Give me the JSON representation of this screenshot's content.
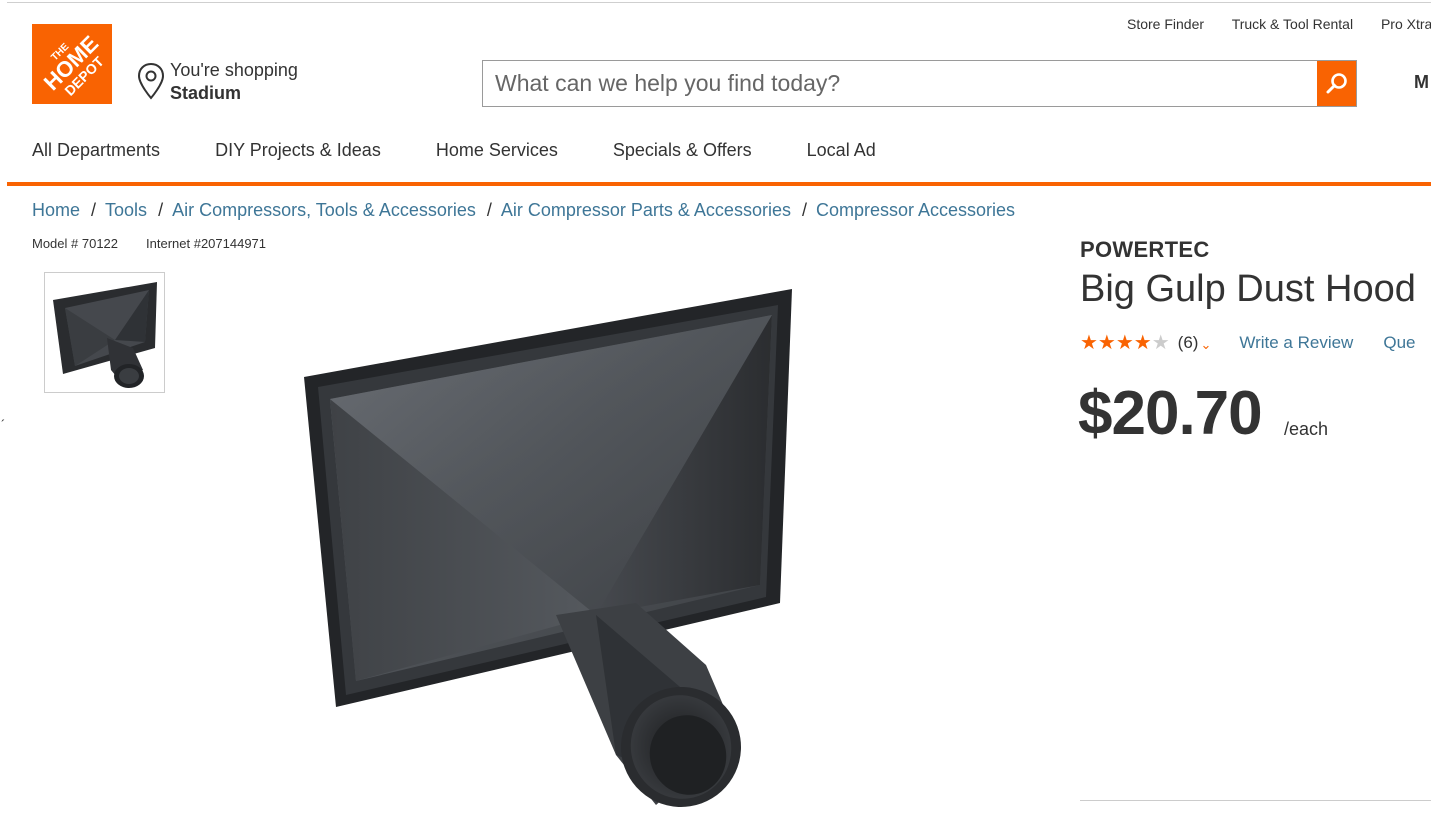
{
  "header": {
    "logo_text": "THE HOME DEPOT",
    "store": {
      "prefix": "You're shopping",
      "name": "Stadium"
    },
    "utility_links": [
      "Store Finder",
      "Truck & Tool Rental",
      "Pro Xtra"
    ],
    "search": {
      "placeholder": "What can we help you find today?",
      "value": ""
    },
    "my_account_initial": "M"
  },
  "nav": {
    "items": [
      "All Departments",
      "DIY Projects & Ideas",
      "Home Services",
      "Specials & Offers",
      "Local Ad"
    ]
  },
  "breadcrumbs": [
    "Home",
    "Tools",
    "Air Compressors, Tools & Accessories",
    "Air Compressor Parts & Accessories",
    "Compressor Accessories"
  ],
  "product": {
    "model": "Model # 70122",
    "internet": "Internet #207144971",
    "brand": "POWERTEC",
    "title": "Big Gulp Dust Hood",
    "rating": {
      "stars": 4,
      "max": 5,
      "count": "(6)"
    },
    "write_review": "Write a Review",
    "questions": "Que",
    "price": "$20.70",
    "unit": "/each"
  },
  "colors": {
    "brand_orange": "#f96302",
    "link_blue": "#3e7697",
    "text": "#333333"
  },
  "icons": {
    "store": "location-pin-icon",
    "search": "magnifier-icon",
    "rating_toggle": "chevron-down-icon"
  }
}
